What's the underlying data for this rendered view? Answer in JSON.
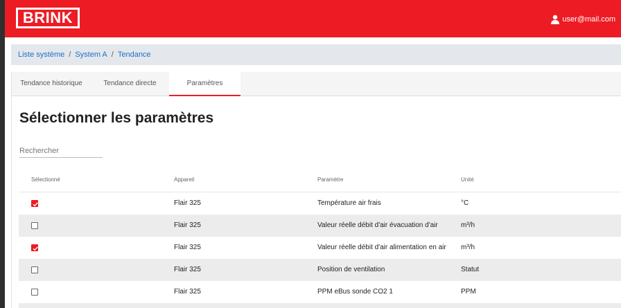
{
  "header": {
    "logo_text": "BRINK",
    "user_email": "user@mail.com",
    "brand_color": "#ed1c24"
  },
  "breadcrumb": {
    "items": [
      "Liste système",
      "System A",
      "Tendance"
    ],
    "separator": "/"
  },
  "tabs": [
    {
      "label": "Tendance historique",
      "active": false
    },
    {
      "label": "Tendance directe",
      "active": false
    },
    {
      "label": "Paramètres",
      "active": true
    }
  ],
  "page_title": "Sélectionner les paramètres",
  "search": {
    "placeholder": "Rechercher",
    "value": ""
  },
  "table": {
    "columns": [
      "Sélectionné",
      "Appareil",
      "Paramètre",
      "Unité"
    ],
    "rows": [
      {
        "selected": true,
        "device": "Flair 325",
        "parameter": "Température air frais",
        "unit": "°C"
      },
      {
        "selected": false,
        "device": "Flair 325",
        "parameter": "Valeur réelle débit d'air évacuation d'air",
        "unit": "m³/h"
      },
      {
        "selected": true,
        "device": "Flair 325",
        "parameter": "Valeur réelle débit d'air alimentation en air",
        "unit": "m³/h"
      },
      {
        "selected": false,
        "device": "Flair 325",
        "parameter": "Position de ventilation",
        "unit": "Statut"
      },
      {
        "selected": false,
        "device": "Flair 325",
        "parameter": "PPM eBus sonde CO2 1",
        "unit": "PPM"
      }
    ]
  }
}
